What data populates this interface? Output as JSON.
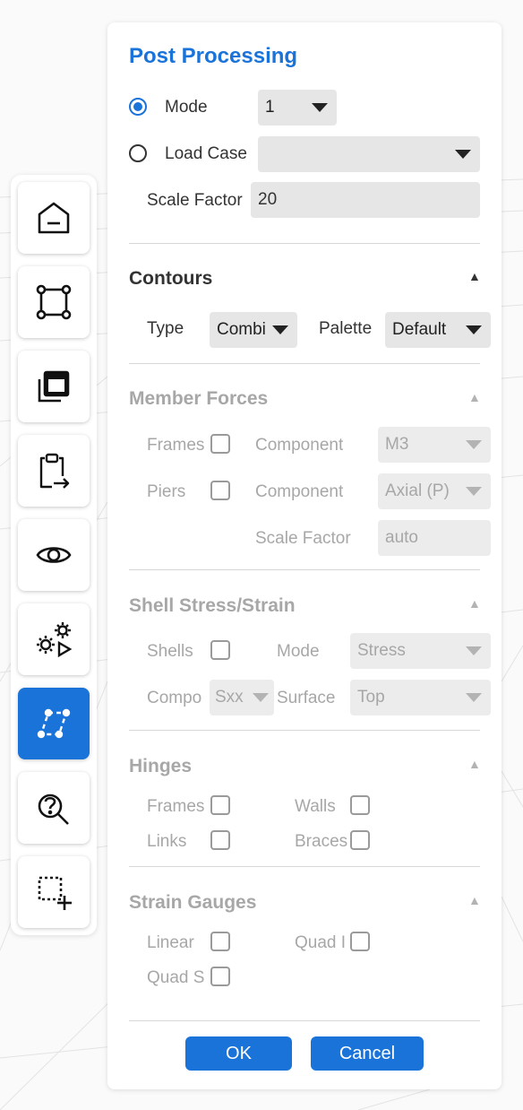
{
  "sidebar": {
    "items": [
      {
        "icon": "home-icon"
      },
      {
        "icon": "nodes-icon"
      },
      {
        "icon": "layers-icon"
      },
      {
        "icon": "clipboard-export-icon"
      },
      {
        "icon": "eye-icon"
      },
      {
        "icon": "gears-run-icon"
      },
      {
        "icon": "post-processing-icon",
        "active": true
      },
      {
        "icon": "search-help-icon"
      },
      {
        "icon": "add-selection-icon"
      }
    ],
    "accent_color": "#1a73d9"
  },
  "panel": {
    "title": "Post Processing",
    "mode_label": "Mode",
    "mode_value": "1",
    "load_case_label": "Load Case",
    "load_case_value": "",
    "scale_factor_label": "Scale Factor",
    "scale_factor_value": "20",
    "contours": {
      "title": "Contours",
      "type_label": "Type",
      "type_value": "Combi",
      "palette_label": "Palette",
      "palette_value": "Default"
    },
    "member_forces": {
      "title": "Member Forces",
      "frames_label": "Frames",
      "frames_component_label": "Component",
      "frames_component_value": "M3",
      "piers_label": "Piers",
      "piers_component_label": "Component",
      "piers_component_value": "Axial (P)",
      "scale_factor_label": "Scale Factor",
      "scale_factor_value": "auto"
    },
    "shell_stress": {
      "title": "Shell Stress/Strain",
      "shells_label": "Shells",
      "mode_label": "Mode",
      "mode_value": "Stress",
      "component_label": "Compo",
      "component_value": "Sxx",
      "surface_label": "Surface",
      "surface_value": "Top"
    },
    "hinges": {
      "title": "Hinges",
      "frames_label": "Frames",
      "walls_label": "Walls",
      "links_label": "Links",
      "braces_label": "Braces"
    },
    "strain_gauges": {
      "title": "Strain Gauges",
      "linear_label": "Linear",
      "quad_label": "Quad I",
      "quad_s_label": "Quad S"
    },
    "ok_label": "OK",
    "cancel_label": "Cancel"
  }
}
